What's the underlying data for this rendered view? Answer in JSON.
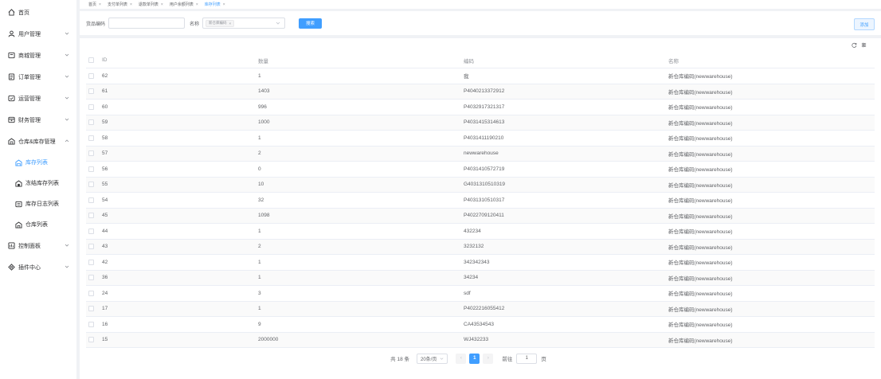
{
  "sidebar": {
    "home": "首页",
    "items": [
      {
        "label": "用户管理"
      },
      {
        "label": "商城管理"
      },
      {
        "label": "订单管理"
      },
      {
        "label": "运营管理"
      },
      {
        "label": "财务管理"
      },
      {
        "label": "仓库&库存管理"
      }
    ],
    "sub_items": [
      {
        "label": "库存列表"
      },
      {
        "label": "冻结库存列表"
      },
      {
        "label": "库存日志列表"
      },
      {
        "label": "仓库列表"
      }
    ],
    "bottom_items": [
      {
        "label": "控制面板"
      },
      {
        "label": "插件中心"
      }
    ]
  },
  "tabs": [
    {
      "label": "首页"
    },
    {
      "label": "支付单列表"
    },
    {
      "label": "退款单列表"
    },
    {
      "label": "用户余额列表"
    },
    {
      "label": "库存列表"
    }
  ],
  "filter": {
    "code_label": "货品编码",
    "code_value": "",
    "name_label": "名称",
    "name_chip": "新仓库编码",
    "search_button": "搜索",
    "add_button": "添加"
  },
  "table": {
    "headers": [
      "ID",
      "数量",
      "编码",
      "名称"
    ],
    "rows": [
      {
        "id": "62",
        "qty": "1",
        "code": "我",
        "name": "新仓库编码(newwarehouse)"
      },
      {
        "id": "61",
        "qty": "1403",
        "code": "P4040213372912",
        "name": "新仓库编码(newwarehouse)"
      },
      {
        "id": "60",
        "qty": "996",
        "code": "P4032917321317",
        "name": "新仓库编码(newwarehouse)"
      },
      {
        "id": "59",
        "qty": "1000",
        "code": "P4031415314613",
        "name": "新仓库编码(newwarehouse)"
      },
      {
        "id": "58",
        "qty": "1",
        "code": "P4031411190210",
        "name": "新仓库编码(newwarehouse)"
      },
      {
        "id": "57",
        "qty": "2",
        "code": "newwarehouse",
        "name": "新仓库编码(newwarehouse)"
      },
      {
        "id": "56",
        "qty": "0",
        "code": "P4031410572719",
        "name": "新仓库编码(newwarehouse)"
      },
      {
        "id": "55",
        "qty": "10",
        "code": "G4031310510319",
        "name": "新仓库编码(newwarehouse)"
      },
      {
        "id": "54",
        "qty": "32",
        "code": "P4031310510317",
        "name": "新仓库编码(newwarehouse)"
      },
      {
        "id": "45",
        "qty": "1098",
        "code": "P4022709120411",
        "name": "新仓库编码(newwarehouse)"
      },
      {
        "id": "44",
        "qty": "1",
        "code": "432234",
        "name": "新仓库编码(newwarehouse)"
      },
      {
        "id": "43",
        "qty": "2",
        "code": "3232132",
        "name": "新仓库编码(newwarehouse)"
      },
      {
        "id": "42",
        "qty": "1",
        "code": "342342343",
        "name": "新仓库编码(newwarehouse)"
      },
      {
        "id": "36",
        "qty": "1",
        "code": "34234",
        "name": "新仓库编码(newwarehouse)"
      },
      {
        "id": "24",
        "qty": "3",
        "code": "sdf",
        "name": "新仓库编码(newwarehouse)"
      },
      {
        "id": "17",
        "qty": "1",
        "code": "P4022216055412",
        "name": "新仓库编码(newwarehouse)"
      },
      {
        "id": "16",
        "qty": "9",
        "code": "CA43534543",
        "name": "新仓库编码(newwarehouse)"
      },
      {
        "id": "15",
        "qty": "2000000",
        "code": "WJ432233",
        "name": "新仓库编码(newwarehouse)"
      }
    ]
  },
  "pagination": {
    "total": "共 18 条",
    "page_size": "20条/页",
    "current_page": "1",
    "goto_label": "前往",
    "goto_value": "1",
    "page_suffix": "页"
  },
  "colors": {
    "accent": "#409eff",
    "border": "#ebeef5"
  },
  "icons": [
    "home-icon",
    "user-icon",
    "shop-icon",
    "order-icon",
    "operation-icon",
    "finance-icon",
    "warehouse-icon",
    "dashboard-icon",
    "plugin-icon",
    "refresh-icon",
    "settings-icon"
  ]
}
